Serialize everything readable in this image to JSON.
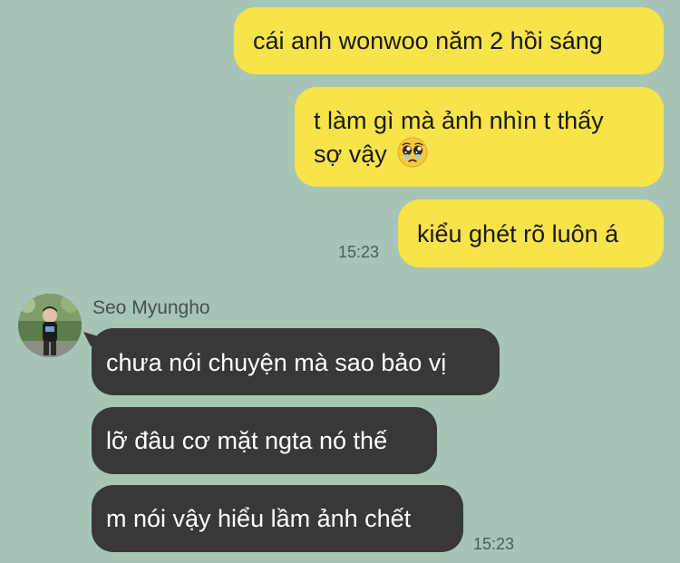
{
  "outgoing": [
    {
      "text": "cái anh wonwoo năm 2 hồi sáng"
    },
    {
      "line1": "t làm gì mà ảnh nhìn t thấy",
      "line2": "sợ vậy",
      "emoji": "pleading-face-emoji"
    },
    {
      "text": "kiểu ghét rõ luôn á"
    }
  ],
  "outgoing_time": "15:23",
  "contact": {
    "name": "Seo Myungho",
    "avatar": "contact-avatar-photo"
  },
  "incoming": [
    {
      "text": "chưa nói chuyện mà sao bảo vị"
    },
    {
      "text": "lỡ đâu cơ mặt ngta nó thế"
    },
    {
      "text": "m nói vậy hiểu lầm ảnh chết"
    }
  ],
  "incoming_time": "15:23",
  "colors": {
    "background": "#a6c5b6",
    "outgoing_bubble": "#f7e34a",
    "incoming_bubble": "#383838"
  }
}
